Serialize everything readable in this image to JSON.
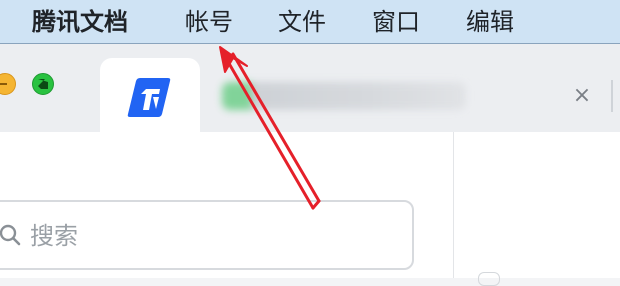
{
  "menubar": {
    "items": [
      {
        "label": "腾讯文档"
      },
      {
        "label": "帐号"
      },
      {
        "label": "文件"
      },
      {
        "label": "窗口"
      },
      {
        "label": "编辑"
      }
    ]
  },
  "tabs": {
    "close_glyph": "×"
  },
  "sidebar": {
    "search": {
      "placeholder": "搜索"
    }
  },
  "icons": {
    "app_logo": "tencent-docs-logo",
    "search": "search-icon",
    "close": "close-icon"
  },
  "colors": {
    "menubar_bg": "#cfe3f4",
    "logo_blue": "#2164f3",
    "annotation_red": "#e5202a"
  }
}
